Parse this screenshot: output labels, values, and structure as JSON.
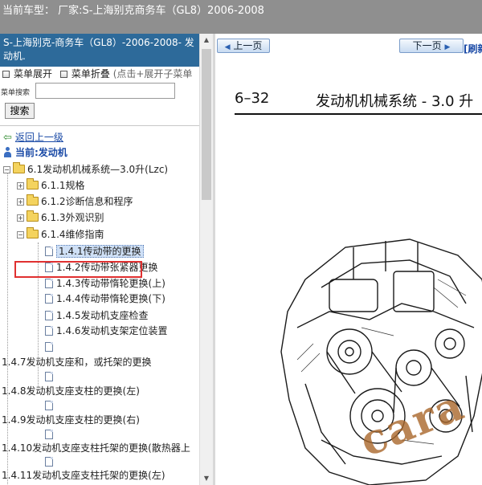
{
  "topbar": {
    "text": "当前车型：  厂家:S-上海别克商务车（GL8）2006-2008"
  },
  "sidebar": {
    "title": "S-上海别克-商务车（GL8）-2006-2008- 发动机.",
    "menu_expand": "菜单展开",
    "menu_collapse": "菜单折叠",
    "menu_hint": "(点击+展开子菜单",
    "search_label": "菜单搜索",
    "search_value": "",
    "search_button": "搜索",
    "back_link": "返回上一级",
    "current": "当前:发动机",
    "root": "6.1发动机机械系统—3.0升(Lzc)",
    "folders": [
      "6.1.1规格",
      "6.1.2诊断信息和程序",
      "6.1.3外观识别",
      "6.1.4维修指南"
    ],
    "pages": [
      "1.4.1传动带的更换",
      "1.4.2传动带张紧器更换",
      "1.4.3传动带惰轮更换(上)",
      "1.4.4传动带惰轮更换(下)",
      "1.4.5发动机支座检查",
      "1.4.6发动机支架定位装置"
    ],
    "orphans": [
      "1.4.7发动机支座和，或托架的更换",
      "1.4.8发动机支座支柱的更换(左)",
      "1.4.9发动机支座支柱的更换(右)",
      "1.4.10发动机支座支柱托架的更换(散热器上",
      "1.4.11发动机支座支柱托架的更换(左)"
    ]
  },
  "viewer": {
    "prev_button": "上一页",
    "next_button": "下一页",
    "refresh": "[刷新",
    "page_number": "6–32",
    "page_title": "发动机机械系统 - 3.0 升",
    "watermark": "cara"
  },
  "colors": {
    "title_bg": "#2d6a9a",
    "topbar_bg": "#8f8f8f",
    "highlight": "#e03030",
    "link": "#1a4aa6"
  }
}
